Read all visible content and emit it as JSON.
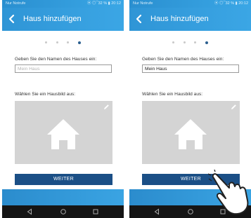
{
  "screens": [
    {
      "status": {
        "carrier": "Nur Notrufe",
        "indicators": "⦿ ◎ ̅ 32 % ▮ 20:12"
      },
      "appbar": {
        "title": "Haus hinzufügen"
      },
      "pager": {
        "count": 4,
        "active_index": 3
      },
      "name_label": "Geben Sie den Namen des Hauses ein:",
      "name_input": {
        "placeholder": "Mein Haus",
        "value": ""
      },
      "image_label": "Wählen Sie ein Hausbild aus:",
      "button": "WEITER"
    },
    {
      "status": {
        "carrier": "Nur Notrufe",
        "indicators": "⦿ ◎ ̅ 32 % ▮ 20:12"
      },
      "appbar": {
        "title": "Haus hinzufügen"
      },
      "pager": {
        "count": 4,
        "active_index": 3
      },
      "name_label": "Geben Sie den Namen des Hauses ein:",
      "name_input": {
        "placeholder": "",
        "value": "Mein Haus"
      },
      "image_label": "Wählen Sie ein Hausbild aus:",
      "button": "WEITER"
    }
  ],
  "icons": {
    "back": "arrow-left-icon",
    "house": "house-icon",
    "edit": "pencil-icon",
    "nav_back": "triangle-back-icon",
    "nav_home": "circle-home-icon",
    "nav_recent": "square-recent-icon",
    "touch": "hand-pointer-icon"
  },
  "colors": {
    "appbar": "#3ba6e5",
    "button": "#1b4f86",
    "image_placeholder": "#d4d4d4",
    "navbar": "#151515"
  }
}
